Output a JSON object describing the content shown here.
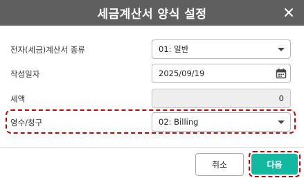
{
  "dialog": {
    "title": "세금계산서 양식 설정",
    "close_icon": "close-icon"
  },
  "form": {
    "invoice_type": {
      "label": "전자(세금)계산서 종류",
      "value": "01: 일반",
      "icon": "chevron-down-icon"
    },
    "date": {
      "label": "작성일자",
      "value": "2025/09/19",
      "icon": "calendar-icon"
    },
    "tax": {
      "label": "세액",
      "value": "0"
    },
    "receipt_claim": {
      "label": "영수/청구",
      "value": "02: Billing",
      "icon": "chevron-down-icon"
    }
  },
  "buttons": {
    "cancel": "취소",
    "next": "다음"
  },
  "colors": {
    "titlebar": "#5f5f5f",
    "primary": "#13b8a0",
    "highlight": "#c40000"
  }
}
